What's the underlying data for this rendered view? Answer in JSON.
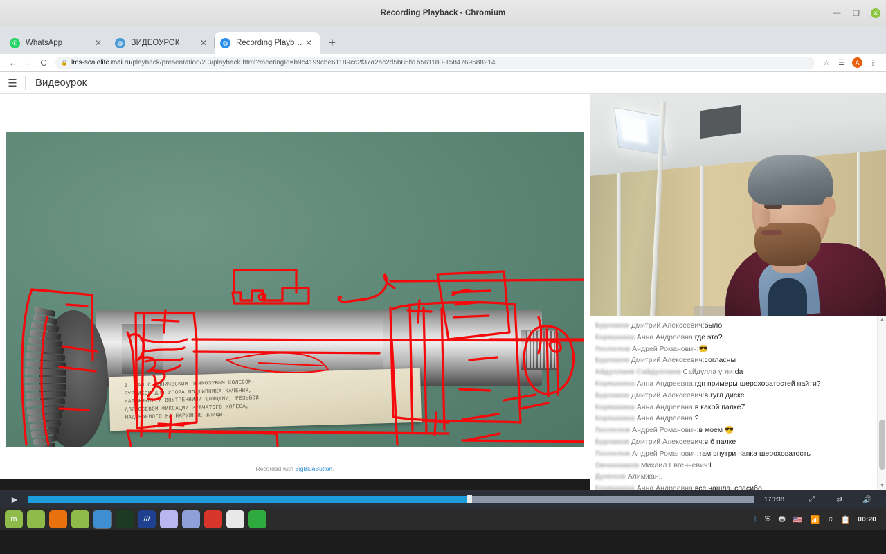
{
  "window": {
    "title": "Recording Playback - Chromium",
    "minimize_label": "—",
    "maximize_label": "❐",
    "close_label": "✕"
  },
  "browser": {
    "tabs": [
      {
        "label": "WhatsApp",
        "favicon": "whatsapp-icon",
        "close_label": "✕",
        "active": false
      },
      {
        "label": "ВИДЕОУРОК",
        "favicon": "globe-icon",
        "close_label": "✕",
        "active": false
      },
      {
        "label": "Recording Playback",
        "favicon": "globe-icon",
        "close_label": "✕",
        "active": true
      }
    ],
    "new_tab_label": "+",
    "back_label": "←",
    "forward_label": "→",
    "reload_label": "C",
    "lock_label": "🔒",
    "url_host": "lms-scalelite.mai.ru",
    "url_path": "/playback/presentation/2.3/playback.html?meetingId=b9c4199cbe61189cc2f37a2ac2d5b85b1b561180-1584769588214",
    "bookmark_label": "☆",
    "reading_list_label": "☰",
    "profile_label": "A",
    "menu_label": "⋮"
  },
  "app": {
    "menu_icon_label": "☰",
    "title": "Видеоурок"
  },
  "slide": {
    "label_lines": [
      "2. ВАЛ С КОНИЧЕСКИМ ПРЯМОЗУБЫМ КОЛЕСОМ,",
      "БУРТИКОМ ДЛЯ УПОРА ПОДШИПНИКА КАЧЕНИЯ,",
      "НАРУЖНЫМИ И ВНУТРЕННИМИ ШЛИЦАМИ, РЕЗЬБОЙ",
      "ДЛЯ ОСЕВОЙ ФИКСАЦИИ ЗУБЧАТОГО КОЛЕСА,",
      "НАДЕВАЕМОГО НА НАРУЖНЫЕ ШЛИЦЫ."
    ],
    "recorded_prefix": "Recorded with ",
    "recorded_brand": "BigBlueButton",
    "recorded_suffix": "."
  },
  "chat": {
    "messages": [
      {
        "name": "Бурлаков",
        "patronymic": "Дмитрий Алексеевич",
        "text": "было"
      },
      {
        "name": "Коряшкина",
        "patronymic": "Анна Андреевна",
        "text": "где это?"
      },
      {
        "name": "Поспелов",
        "patronymic": "Андрей Романович",
        "text": "😎"
      },
      {
        "name": "Бурлаков",
        "patronymic": "Дмитрий Алексеевич",
        "text": "согласны"
      },
      {
        "name": "Абдуллаев Сайдуллаев",
        "patronymic": "Сайдулла угли",
        "text": "da"
      },
      {
        "name": "Коряшкина",
        "patronymic": "Анна Андреевна",
        "text": "гдн примеры шероховатостей найти?"
      },
      {
        "name": "Бурлаков",
        "patronymic": "Дмитрий Алексеевич",
        "text": "в гугл диске"
      },
      {
        "name": "Коряшкина",
        "patronymic": "Анна Андреевна",
        "text": "в какой палке7"
      },
      {
        "name": "Коряшкина",
        "patronymic": "Анна Андреевна",
        "text": "?"
      },
      {
        "name": "Поспелов",
        "patronymic": "Андрей Романович",
        "text": "в моем 😎"
      },
      {
        "name": "Бурлаков",
        "patronymic": "Дмитрий Алексеевич",
        "text": "в б палке"
      },
      {
        "name": "Поспелов",
        "patronymic": "Андрей Романович",
        "text": "там внутри папка шероховатость"
      },
      {
        "name": "Овчинников",
        "patronymic": "Михаил Евгеньевич",
        "text": "l"
      },
      {
        "name": "Дуненов",
        "patronymic": "Алимжан",
        "text": "."
      },
      {
        "name": "Коряшкина",
        "patronymic": "Анна Андреевна",
        "text": "все нашла, спасибо"
      }
    ],
    "scroll_up_label": "▲",
    "scroll_down_label": "▼"
  },
  "player": {
    "play_label": "▶",
    "time": "170:38",
    "progress_percent": 60.5,
    "fullscreen_label": "⤢",
    "speed_label": "⇄",
    "volume_label": "🔊"
  },
  "taskbar": {
    "apps": [
      {
        "name": "mint-menu-icon",
        "glyph": "m",
        "color": "#8fbb4a",
        "selected": false
      },
      {
        "name": "show-desktop-icon",
        "glyph": "",
        "color": "#8fbb4a",
        "selected": false
      },
      {
        "name": "firefox-icon",
        "glyph": "",
        "color": "#e8700d",
        "selected": false
      },
      {
        "name": "file-manager-icon",
        "glyph": "",
        "color": "#8fbb4a",
        "selected": false
      },
      {
        "name": "chromium-icon",
        "glyph": "",
        "color": "#3d8fd1",
        "selected": true
      },
      {
        "name": "system-monitor-icon",
        "glyph": "",
        "color": "#1d3a22",
        "selected": false
      },
      {
        "name": "wps-writer-icon",
        "glyph": "///",
        "color": "#1f3f8f",
        "selected": false
      },
      {
        "name": "text-editor-icon",
        "glyph": "",
        "color": "#b9b6ef",
        "selected": false
      },
      {
        "name": "screenshot-icon",
        "glyph": "",
        "color": "#8f9fd8",
        "selected": false
      },
      {
        "name": "gimp-icon",
        "glyph": "",
        "color": "#d8352a",
        "selected": false
      },
      {
        "name": "inkscape-icon",
        "glyph": "",
        "color": "#e8e8e8",
        "selected": false
      },
      {
        "name": "spreadsheet-icon",
        "glyph": "",
        "color": "#2faa3e",
        "selected": false
      }
    ],
    "tray": [
      {
        "name": "bluetooth-icon",
        "glyph": "ᛒ",
        "color": "#4aa3e8"
      },
      {
        "name": "shield-icon",
        "glyph": "⛨",
        "color": "#dcdcdc"
      },
      {
        "name": "printer-icon",
        "glyph": "🖶",
        "color": "#dcdcdc"
      },
      {
        "name": "keyboard-layout-icon",
        "glyph": "🇺🇸",
        "color": "#dcdcdc"
      },
      {
        "name": "wifi-icon",
        "glyph": "📶",
        "color": "#dcdcdc"
      },
      {
        "name": "sound-icon",
        "glyph": "♫",
        "color": "#dcdcdc"
      },
      {
        "name": "clipboard-icon",
        "glyph": "📋",
        "color": "#dcdcdc"
      }
    ],
    "clock": "00:20"
  }
}
